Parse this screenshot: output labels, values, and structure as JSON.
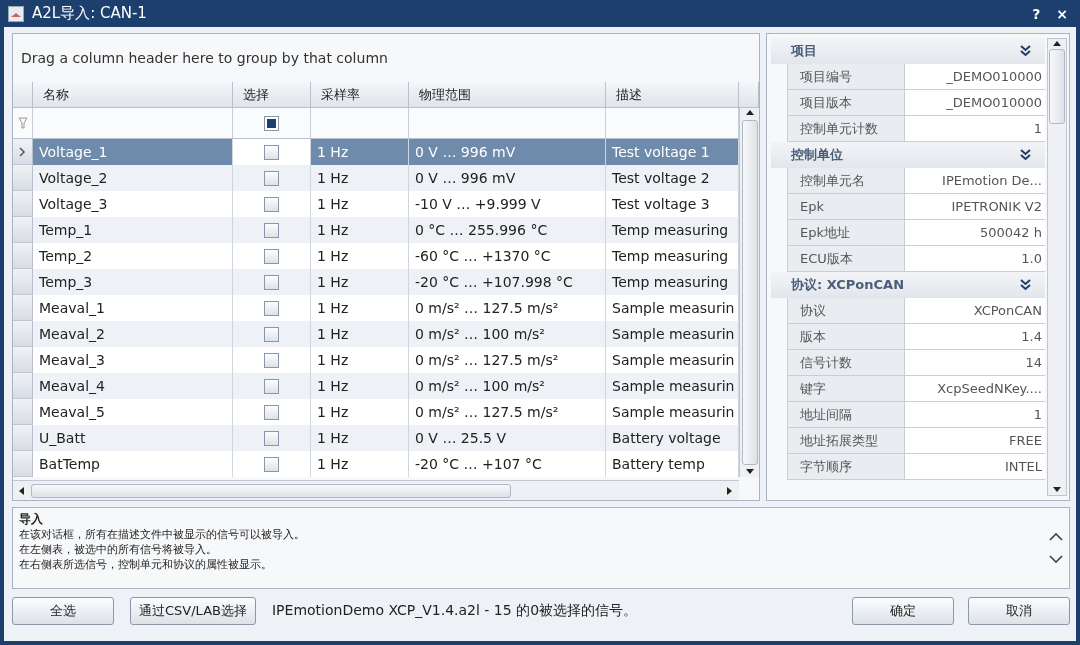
{
  "window": {
    "title": "A2L导入: CAN-1",
    "title_buttons": [
      "?",
      "×"
    ]
  },
  "group_hint": "Drag a column header here to group by that column",
  "table": {
    "columns": [
      "名称",
      "选择",
      "采样率",
      "物理范围",
      "描述"
    ],
    "filter_checked": true,
    "rows": [
      {
        "name": "Voltage_1",
        "checked": false,
        "rate": "1 Hz",
        "range": "0 V … 996 mV",
        "desc": "Test voltage 1",
        "selected": true
      },
      {
        "name": "Voltage_2",
        "checked": false,
        "rate": "1 Hz",
        "range": "0 V … 996 mV",
        "desc": "Test voltage 2",
        "selected": false
      },
      {
        "name": "Voltage_3",
        "checked": false,
        "rate": "1 Hz",
        "range": "-10 V … +9.999 V",
        "desc": "Test voltage 3",
        "selected": false
      },
      {
        "name": "Temp_1",
        "checked": false,
        "rate": "1 Hz",
        "range": "0 °C … 255.996 °C",
        "desc": "Temp measuring",
        "selected": false
      },
      {
        "name": "Temp_2",
        "checked": false,
        "rate": "1 Hz",
        "range": "-60 °C … +1370 °C",
        "desc": "Temp measuring",
        "selected": false
      },
      {
        "name": "Temp_3",
        "checked": false,
        "rate": "1 Hz",
        "range": "-20 °C … +107.998 °C",
        "desc": "Temp measuring",
        "selected": false
      },
      {
        "name": "Meaval_1",
        "checked": false,
        "rate": "1 Hz",
        "range": "0 m/s² … 127.5 m/s²",
        "desc": "Sample measurin",
        "selected": false
      },
      {
        "name": "Meaval_2",
        "checked": false,
        "rate": "1 Hz",
        "range": "0 m/s² … 100 m/s²",
        "desc": "Sample measurin",
        "selected": false
      },
      {
        "name": "Meaval_3",
        "checked": false,
        "rate": "1 Hz",
        "range": "0 m/s² … 127.5 m/s²",
        "desc": "Sample measurin",
        "selected": false
      },
      {
        "name": "Meaval_4",
        "checked": false,
        "rate": "1 Hz",
        "range": "0 m/s² … 100 m/s²",
        "desc": "Sample measurin",
        "selected": false
      },
      {
        "name": "Meaval_5",
        "checked": false,
        "rate": "1 Hz",
        "range": "0 m/s² … 127.5 m/s²",
        "desc": "Sample measurin",
        "selected": false
      },
      {
        "name": "U_Batt",
        "checked": false,
        "rate": "1 Hz",
        "range": "0 V … 25.5 V",
        "desc": "Battery voltage",
        "selected": false
      },
      {
        "name": "BatTemp",
        "checked": false,
        "rate": "1 Hz",
        "range": "-20 °C … +107 °C",
        "desc": "Battery temp",
        "selected": false
      }
    ]
  },
  "properties": [
    {
      "title": "项目",
      "expanded": true,
      "rows": [
        {
          "label": "项目编号",
          "value": "_DEMO010000"
        },
        {
          "label": "项目版本",
          "value": "_DEMO010000"
        },
        {
          "label": "控制单元计数",
          "value": "1"
        }
      ]
    },
    {
      "title": "控制单位",
      "expanded": true,
      "rows": [
        {
          "label": "控制单元名",
          "value": "IPEmotion De..."
        },
        {
          "label": "Epk",
          "value": "IPETRONIK V2"
        },
        {
          "label": "Epk地址",
          "value": "500042 h"
        },
        {
          "label": "ECU版本",
          "value": "1.0"
        }
      ]
    },
    {
      "title": "协议: XCPonCAN",
      "expanded": true,
      "rows": [
        {
          "label": "协议",
          "value": "XCPonCAN"
        },
        {
          "label": "版本",
          "value": "1.4"
        },
        {
          "label": "信号计数",
          "value": "14"
        },
        {
          "label": "键字",
          "value": "XcpSeedNKey...."
        },
        {
          "label": "地址间隔",
          "value": "1"
        },
        {
          "label": "地址拓展类型",
          "value": "FREE"
        },
        {
          "label": "字节顺序",
          "value": "INTEL"
        }
      ]
    }
  ],
  "help": {
    "title": "导入",
    "lines": [
      "在该对话框，所有在描述文件中被显示的信号可以被导入。",
      "在左侧表，被选中的所有信号将被导入。",
      "在右侧表所选信号，控制单元和协议的属性被显示。"
    ]
  },
  "footer": {
    "buttons": [
      "全选",
      "通过CSV/LAB选择"
    ],
    "status": "IPEmotionDemo XCP_V1.4.a2l  -  15 的0被选择的信号。",
    "actions": [
      "确定",
      "取消"
    ]
  }
}
